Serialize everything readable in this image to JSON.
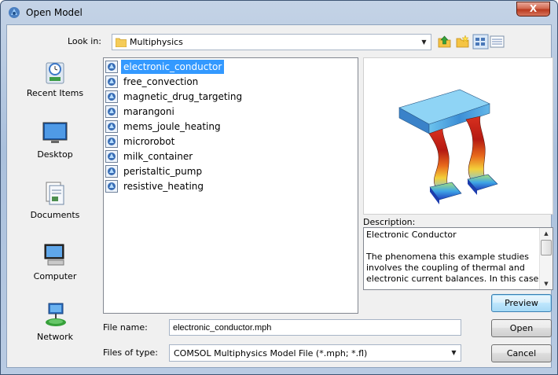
{
  "window": {
    "title": "Open Model",
    "close_label": "X"
  },
  "look_in": {
    "label": "Look in:",
    "value": "Multiphysics"
  },
  "toolbar": {
    "icons": [
      "up-folder-icon",
      "new-folder-icon",
      "views-icon",
      "details-view-icon"
    ]
  },
  "places": [
    {
      "label": "Recent Items",
      "icon": "recent-items-icon"
    },
    {
      "label": "Desktop",
      "icon": "desktop-icon"
    },
    {
      "label": "Documents",
      "icon": "documents-icon"
    },
    {
      "label": "Computer",
      "icon": "computer-icon"
    },
    {
      "label": "Network",
      "icon": "network-icon"
    }
  ],
  "files": [
    {
      "name": "electronic_conductor",
      "selected": true
    },
    {
      "name": "free_convection",
      "selected": false
    },
    {
      "name": "magnetic_drug_targeting",
      "selected": false
    },
    {
      "name": "marangoni",
      "selected": false
    },
    {
      "name": "mems_joule_heating",
      "selected": false
    },
    {
      "name": "microrobot",
      "selected": false
    },
    {
      "name": "milk_container",
      "selected": false
    },
    {
      "name": "peristaltic_pump",
      "selected": false
    },
    {
      "name": "resistive_heating",
      "selected": false
    }
  ],
  "description": {
    "label": "Description:",
    "title": "Electronic Conductor",
    "body": "The phenomena this example studies involves the coupling of thermal and electronic current balances. In this case"
  },
  "buttons": {
    "preview": "Preview",
    "open": "Open",
    "cancel": "Cancel"
  },
  "file_name": {
    "label": "File name:",
    "value": "electronic_conductor.mph"
  },
  "file_type": {
    "label": "Files of type:",
    "value": "COMSOL Multiphysics Model File (*.mph; *.fl)"
  },
  "colors": {
    "selection": "#3399ff",
    "dialog_bg": "#f0f0f0",
    "close_red": "#c7462b"
  }
}
